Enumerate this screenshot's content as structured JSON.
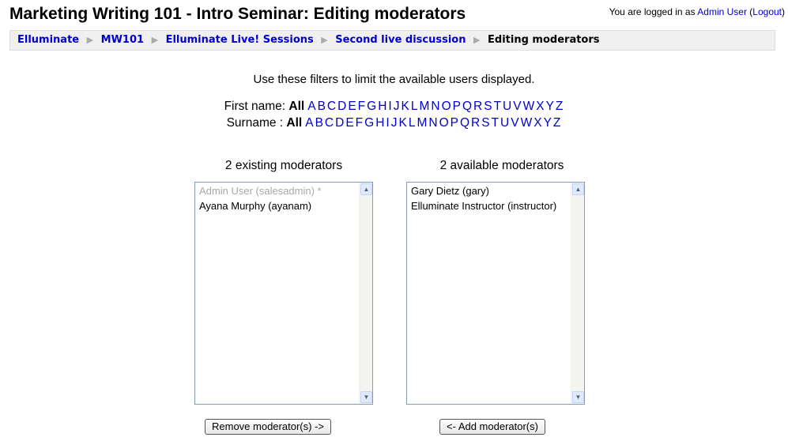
{
  "page": {
    "title": "Marketing Writing 101 - Intro Seminar: Editing moderators",
    "login_prefix": "You are logged in as",
    "login_user": "Admin User",
    "logout_label": "Logout"
  },
  "breadcrumb": {
    "items": [
      "Elluminate",
      "MW101",
      "Elluminate Live! Sessions",
      "Second live discussion"
    ],
    "current": "Editing moderators"
  },
  "filters": {
    "intro": "Use these filters to limit the available users displayed.",
    "firstname_label": "First name:",
    "surname_label": "Surname :",
    "all_label": "All",
    "letters": [
      "A",
      "B",
      "C",
      "D",
      "E",
      "F",
      "G",
      "H",
      "I",
      "J",
      "K",
      "L",
      "M",
      "N",
      "O",
      "P",
      "Q",
      "R",
      "S",
      "T",
      "U",
      "V",
      "W",
      "X",
      "Y",
      "Z"
    ]
  },
  "existing": {
    "title": "2 existing moderators",
    "options": [
      {
        "label": "Admin User (salesadmin) *",
        "disabled": true
      },
      {
        "label": "Ayana Murphy (ayanam)",
        "disabled": false
      }
    ],
    "button_label": "Remove moderator(s) ->"
  },
  "available": {
    "title": "2 available moderators",
    "options": [
      {
        "label": "Gary Dietz (gary)",
        "disabled": false
      },
      {
        "label": "Elluminate Instructor (instructor)",
        "disabled": false
      }
    ],
    "button_label": "<- Add moderator(s)"
  },
  "icons": {
    "scroll_up": "scroll-up-arrow-icon",
    "scroll_down": "scroll-down-arrow-icon",
    "breadcrumb_sep": "triangle-right-icon"
  }
}
